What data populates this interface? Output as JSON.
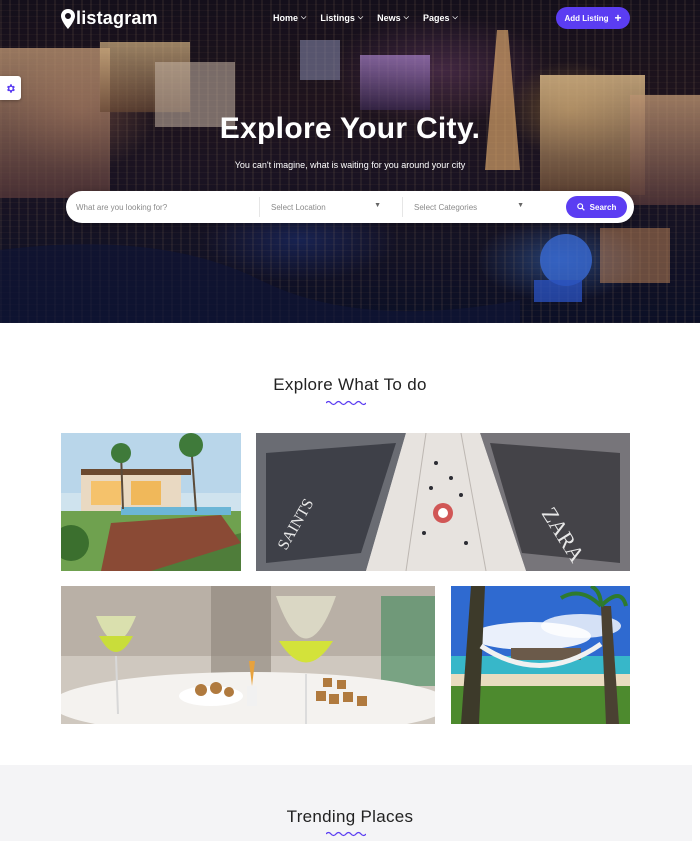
{
  "brand": {
    "name": "listagram"
  },
  "nav": {
    "items": [
      {
        "label": "Home"
      },
      {
        "label": "Listings"
      },
      {
        "label": "News"
      },
      {
        "label": "Pages"
      }
    ],
    "add_listing": "Add Listing",
    "add_icon": "plus-icon"
  },
  "hero": {
    "title": "Explore Your City.",
    "subtitle": "You can't imagine, what is waiting for you around your city"
  },
  "search": {
    "what_placeholder": "What are you looking for?",
    "location_placeholder": "Select Location",
    "category_placeholder": "Select Categories",
    "button_label": "Search",
    "button_icon": "search-icon"
  },
  "explore": {
    "title": "Explore What To do",
    "tiles": [
      {
        "name": "resort-villa-image"
      },
      {
        "name": "shopping-mall-image"
      },
      {
        "name": "restaurant-drinks-image"
      },
      {
        "name": "beach-hammock-image"
      }
    ]
  },
  "trending": {
    "title": "Trending Places"
  },
  "colors": {
    "accent": "#5b3df2",
    "white": "#ffffff"
  }
}
